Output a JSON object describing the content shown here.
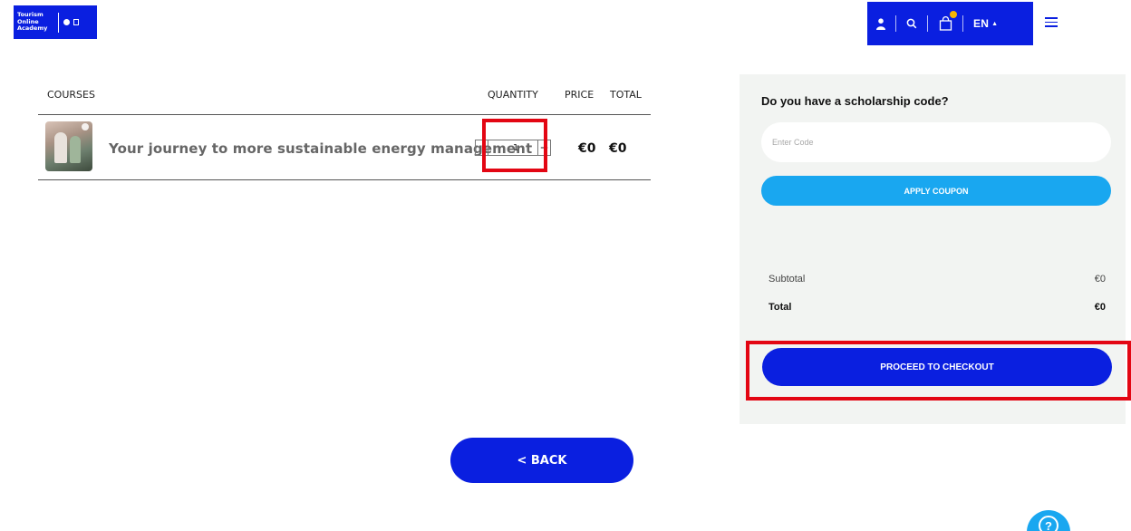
{
  "brand": {
    "logo_text": "Tourism Online Academy",
    "color": "#0a1fe0",
    "accent_light": "#19a7f0",
    "highlight": "#e30613"
  },
  "header": {
    "icons": [
      "user-icon",
      "search-icon",
      "cart-icon"
    ],
    "language": "EN"
  },
  "cart_table": {
    "headers": {
      "courses": "COURSES",
      "quantity": "QUANTITY",
      "price": "PRICE",
      "total": "TOTAL"
    },
    "rows": [
      {
        "name": "Your journey to more sustainable energy management",
        "quantity": "1",
        "price": "€0",
        "total": "€0"
      }
    ]
  },
  "scholarship": {
    "title": "Do you have a scholarship code?",
    "placeholder": "Enter Code",
    "apply_label": "APPLY COUPON"
  },
  "summary": {
    "subtotal_label": "Subtotal",
    "subtotal_value": "€0",
    "total_label": "Total",
    "total_value": "€0",
    "checkout_label": "PROCEED TO CHECKOUT"
  },
  "back_label": "< BACK"
}
